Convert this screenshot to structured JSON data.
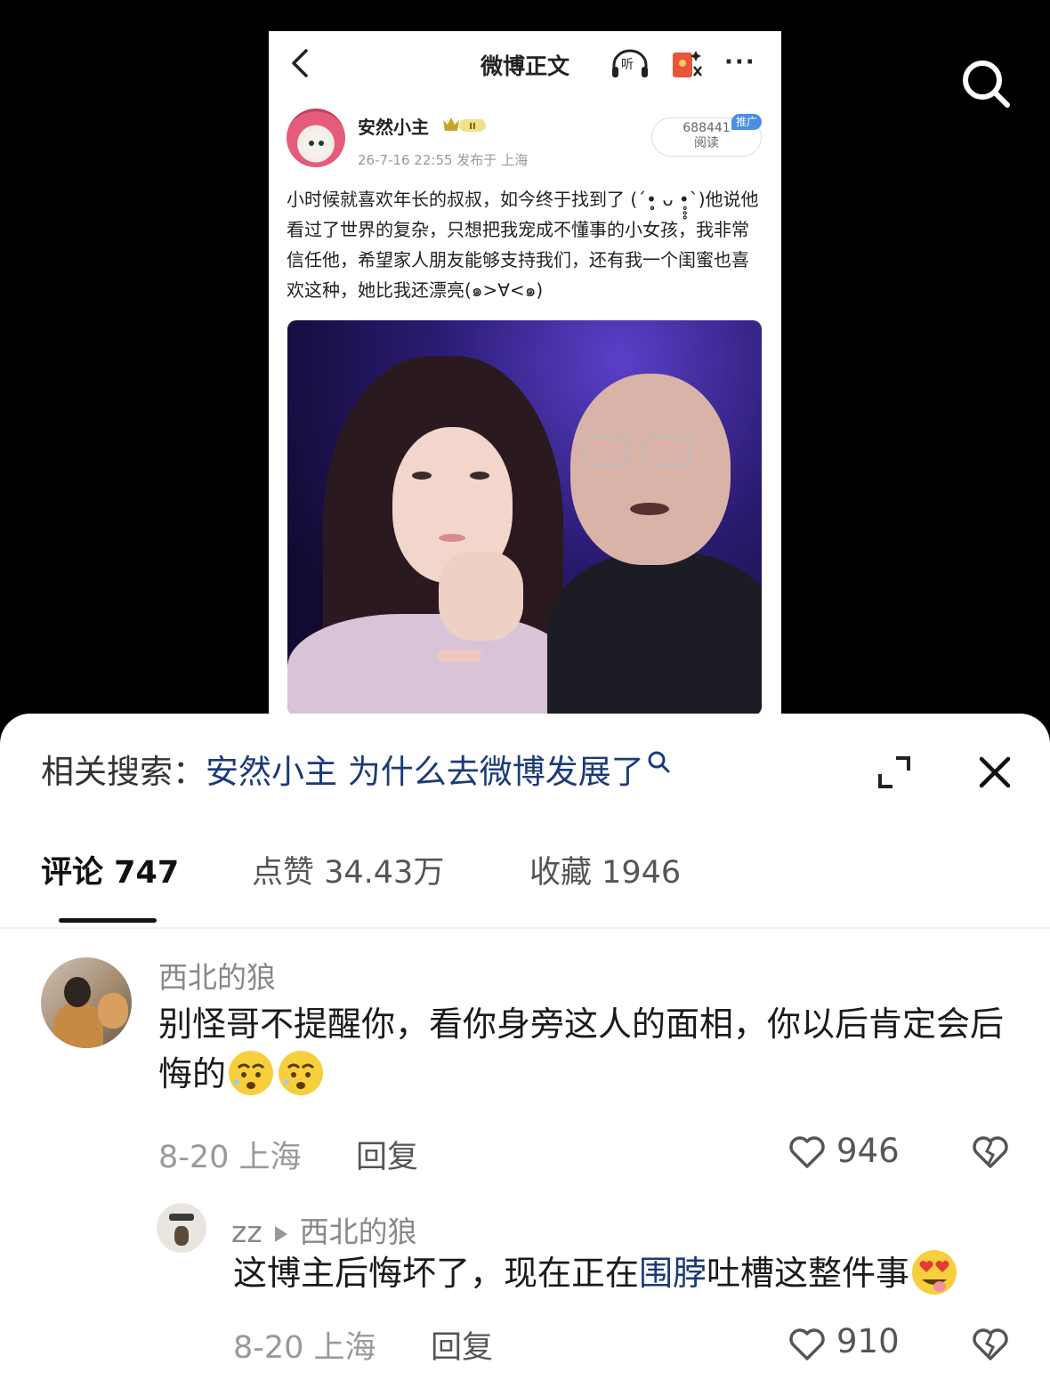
{
  "weibo": {
    "title": "微博正文",
    "listen_label": "听",
    "more": "···",
    "author_name": "安然小主",
    "badge_level": "II",
    "post_meta": "26-7-16 22:55  发布于 上海",
    "reads_count": "688441",
    "reads_label": "阅读",
    "promo_tag": "推广",
    "post_text": "小时候就喜欢年长的叔叔，如今终于找到了 (´•̥̥̥ ᴗ •̥̥̥`)他说他看过了世界的复杂，只想把我宠成不懂事的小女孩，我非常信任他，希望家人朋友能够支持我们，还有我一个闺蜜也喜欢这种，她比我还漂亮(๑>∀<๑)"
  },
  "related_search": {
    "label": "相关搜索：",
    "query": "安然小主 为什么去微博发展了"
  },
  "tabs": [
    {
      "label": "评论 747",
      "active": true
    },
    {
      "label": "点赞 34.43万",
      "active": false
    },
    {
      "label": "收藏 1946",
      "active": false
    }
  ],
  "comment": {
    "username": "西北的狼",
    "text": "别怪哥不提醒你，看你身旁这人的面相，你以后肯定会后悔的",
    "meta": "8-20  上海",
    "reply_label": "回复",
    "like_count": "946"
  },
  "reply": {
    "username": "zz",
    "reply_to": "西北的狼",
    "text_before": "这博主后悔坏了，现在正在",
    "text_link": "围脖",
    "text_after": "吐槽这整件事",
    "meta": "8-20  上海",
    "reply_label": "回复",
    "like_count": "910"
  },
  "colors": {
    "link": "#1b3a7a",
    "muted": "#999999",
    "text": "#1a1a1a",
    "weibo_promo": "#4a90e2"
  }
}
